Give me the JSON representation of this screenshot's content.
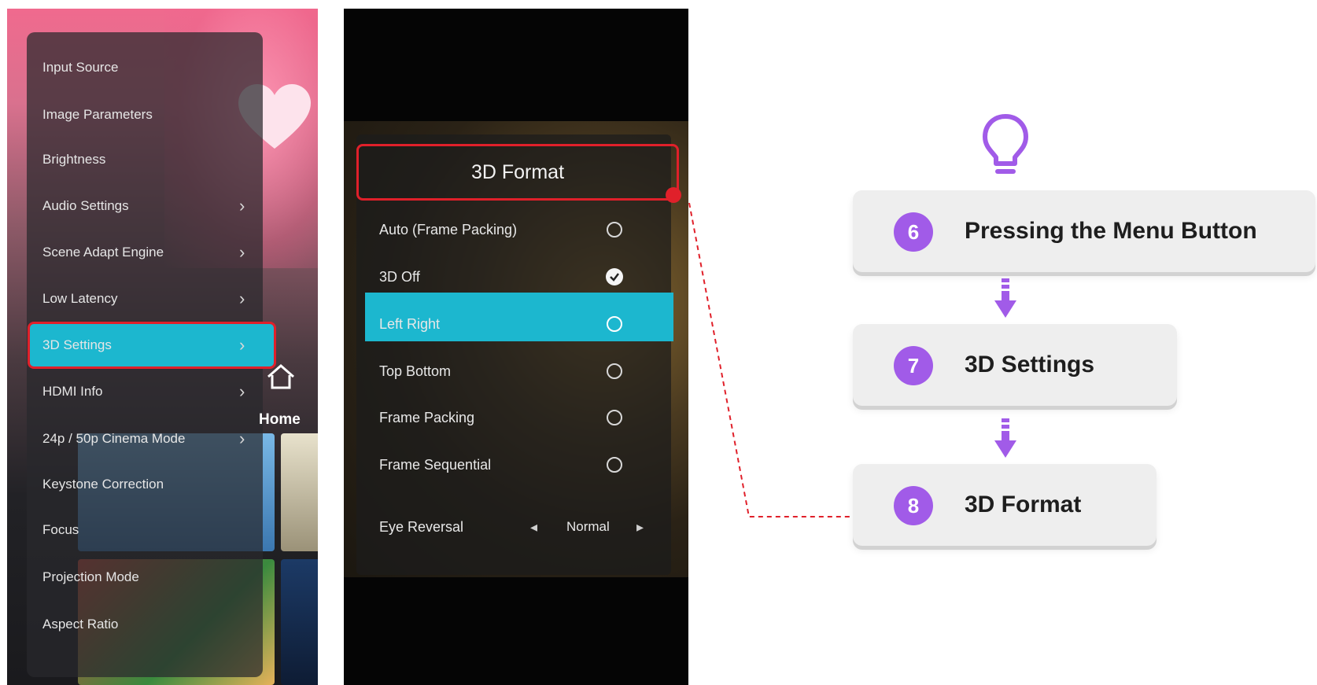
{
  "left_screen": {
    "menu_items": [
      {
        "label": "Input Source",
        "chevron": false
      },
      {
        "label": "Image Parameters",
        "chevron": false
      },
      {
        "label": "Brightness",
        "chevron": false
      },
      {
        "label": "Audio Settings",
        "chevron": true
      },
      {
        "label": "Scene Adapt Engine",
        "chevron": true
      },
      {
        "label": "Low Latency",
        "chevron": true
      },
      {
        "label": "3D Settings",
        "chevron": true,
        "selected": true
      },
      {
        "label": "HDMI Info",
        "chevron": true
      },
      {
        "label": "24p / 50p Cinema Mode",
        "chevron": true
      },
      {
        "label": "Keystone Correction",
        "chevron": false
      },
      {
        "label": "Focus",
        "chevron": false
      },
      {
        "label": "Projection Mode",
        "chevron": false
      },
      {
        "label": "Aspect Ratio",
        "chevron": false
      }
    ],
    "home_label": "Home",
    "accent": "#1cb7cf",
    "highlight": "#e0202a"
  },
  "middle_screen": {
    "title": "3D Format",
    "options": [
      {
        "label": "Auto (Frame Packing)",
        "state": "unchecked"
      },
      {
        "label": "3D Off",
        "state": "checked"
      },
      {
        "label": "Left Right",
        "state": "unchecked",
        "selected": true
      },
      {
        "label": "Top Bottom",
        "state": "unchecked"
      },
      {
        "label": "Frame Packing",
        "state": "unchecked"
      },
      {
        "label": "Frame Sequential",
        "state": "unchecked"
      }
    ],
    "eye_reversal": {
      "label": "Eye Reversal",
      "value": "Normal"
    }
  },
  "flow": {
    "icon": "lightbulb-icon",
    "steps": [
      {
        "number": "6",
        "label": "Pressing the Menu Button"
      },
      {
        "number": "7",
        "label": "3D Settings"
      },
      {
        "number": "8",
        "label": "3D Format"
      }
    ],
    "accent": "#a15be8"
  }
}
